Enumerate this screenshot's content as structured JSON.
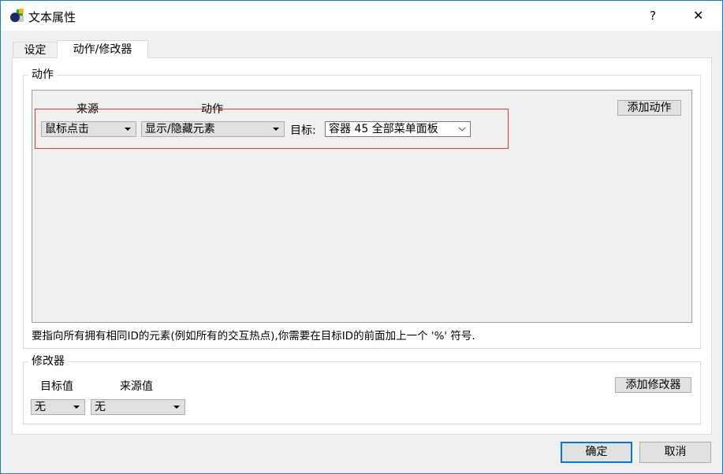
{
  "window": {
    "title": "文本属性",
    "help": "?",
    "close": "✕"
  },
  "tabs": [
    {
      "label": "设定",
      "active": false
    },
    {
      "label": "动作/修改器",
      "active": true
    }
  ],
  "actions": {
    "group_label": "动作",
    "source_header": "来源",
    "action_header": "动作",
    "source_value": "鼠标点击",
    "action_value": "显示/隐藏元素",
    "target_label": "目标:",
    "target_value": "容器 45 全部菜单面板",
    "add_button": "添加动作",
    "hint": "要指向所有拥有相同ID的元素(例如所有的交互热点),你需要在目标ID的前面加上一个 '%' 符号.",
    "selected_row_color": "#e53935"
  },
  "modifiers": {
    "group_label": "修改器",
    "target_header": "目标值",
    "source_header": "来源值",
    "target_value": "无",
    "source_value": "无",
    "add_button": "添加修改器"
  },
  "footer": {
    "ok": "确定",
    "cancel": "取消"
  },
  "colors": {
    "accent": "#0078d7"
  }
}
